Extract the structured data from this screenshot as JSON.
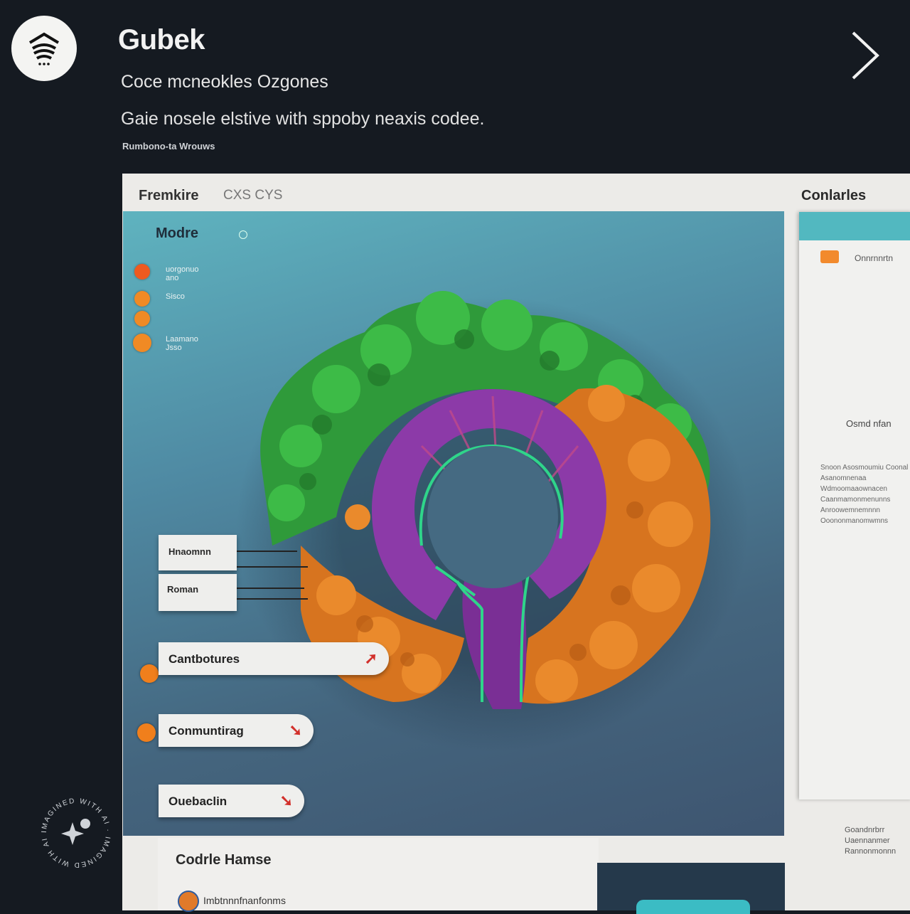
{
  "header": {
    "title": "Gubek",
    "subtitle": "Coce mcneokles Ozgones",
    "description": "Gaie nosele elstive with sppoby neaxis codee.",
    "small_text": "Rumbono-ta Wrouws"
  },
  "panel": {
    "title": "Fremkire",
    "subtitle": "CXS CYS",
    "right_title": "Conlarles"
  },
  "viz": {
    "nodes_label": "Modre",
    "legend": [
      {
        "label": "uorgonuo ano"
      },
      {
        "label": "Sisco"
      },
      {
        "label": ""
      },
      {
        "label": "Laamano Jsso"
      }
    ],
    "callouts": [
      {
        "label": "Hnaomnn"
      },
      {
        "label": "Roman"
      }
    ],
    "pills": [
      {
        "label": "Cantbotures"
      },
      {
        "label": "Conmuntirag"
      },
      {
        "label": "Ouebaclin"
      }
    ]
  },
  "sidebar": {
    "item": "Onnrnnrtn",
    "label": "Osmd nfan",
    "text": "Snoon Asosmoumiu Coonal Asanomnenaa Wdmoomaaownacen Caanmamonmenunns Anroowemnemnnn Ooononmanomwmns"
  },
  "footer_right": "Goandnrbrr Uaennanmer Rannonmonnn",
  "code_home": {
    "title": "Codrle Hamse",
    "item": "Imbtnnnfnanfonms"
  },
  "watermark": "IMAGINED WITH AI",
  "colors": {
    "background": "#151a21",
    "accent_orange": "#f08a24",
    "accent_teal": "#52b8c0",
    "foliage_green": "#2f9a3a",
    "foliage_purple": "#8c3aa8"
  }
}
